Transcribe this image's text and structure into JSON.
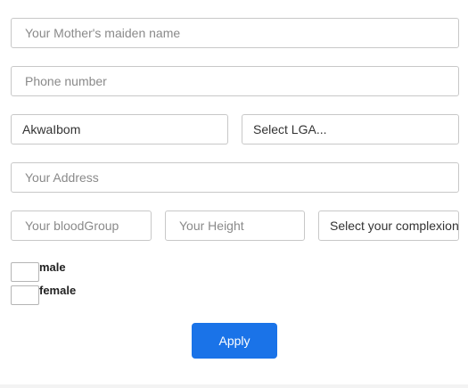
{
  "form": {
    "mother_maiden_placeholder": "Your Mother's maiden name",
    "phone_placeholder": "Phone number",
    "state_value": "AkwaIbom",
    "lga_select": "Select LGA...",
    "address_placeholder": "Your Address",
    "blood_group_placeholder": "Your bloodGroup",
    "height_placeholder": "Your Height",
    "complexion_select": "Select your complexion",
    "gender_options": [
      {
        "label": "male"
      },
      {
        "label": "female"
      }
    ],
    "apply_label": "Apply"
  },
  "colors": {
    "accent": "#1a73e8",
    "border": "#c8c8c8"
  }
}
